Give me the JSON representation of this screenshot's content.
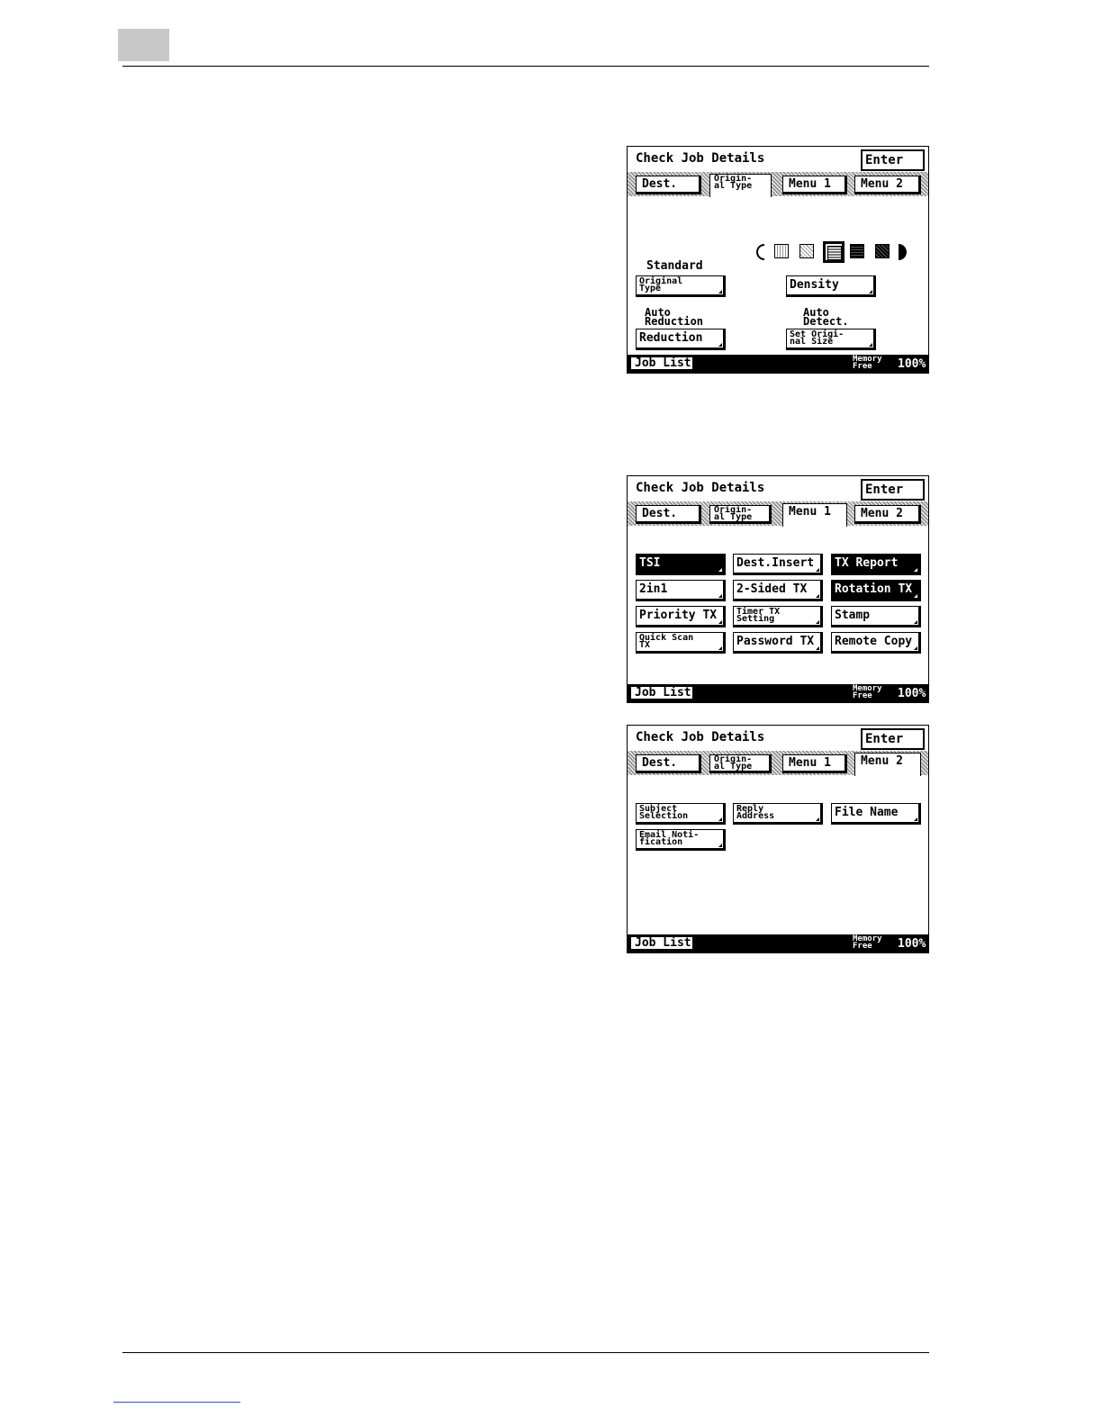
{
  "screens": [
    {
      "title": "Check Job Details",
      "enter_label": "Enter",
      "tabs": {
        "dest": "Dest.",
        "original_type": "Origin-\nal Type",
        "menu1": "Menu 1",
        "menu2": "Menu 2"
      },
      "active_tab": "original_type",
      "original_type_value": "Standard",
      "original_type_button": "Original\nType",
      "density_button": "Density",
      "reduction_value": "Auto\nReduction",
      "reduction_button": "Reduction",
      "size_value": "Auto\nDetect.",
      "size_button": "Set Origi-\nnal Size",
      "density_levels": 6,
      "density_selected": 3,
      "job_list_label": "Job List",
      "memory_label": "Memory\nFree",
      "memory_value": "100%"
    },
    {
      "title": "Check Job Details",
      "enter_label": "Enter",
      "tabs": {
        "dest": "Dest.",
        "original_type": "Origin-\nal Type",
        "menu1": "Menu 1",
        "menu2": "Menu 2"
      },
      "active_tab": "menu1",
      "buttons": [
        {
          "label": "TSI",
          "selected": true
        },
        {
          "label": "Dest.Insert",
          "selected": false
        },
        {
          "label": "TX Report",
          "selected": true
        },
        {
          "label": "2in1",
          "selected": false
        },
        {
          "label": "2-Sided TX",
          "selected": false
        },
        {
          "label": "Rotation TX",
          "selected": true
        },
        {
          "label": "Priority TX",
          "selected": false
        },
        {
          "label": "Timer TX\nSetting",
          "selected": false
        },
        {
          "label": "Stamp",
          "selected": false
        },
        {
          "label": "Quick Scan\nTX",
          "selected": false
        },
        {
          "label": "Password TX",
          "selected": false
        },
        {
          "label": "Remote Copy",
          "selected": false
        }
      ],
      "job_list_label": "Job List",
      "memory_label": "Memory\nFree",
      "memory_value": "100%"
    },
    {
      "title": "Check Job Details",
      "enter_label": "Enter",
      "tabs": {
        "dest": "Dest.",
        "original_type": "Origin-\nal Type",
        "menu1": "Menu 1",
        "menu2": "Menu 2"
      },
      "active_tab": "menu2",
      "buttons": [
        {
          "label": "Subject\nSelection"
        },
        {
          "label": "Reply\nAddress"
        },
        {
          "label": "File Name"
        },
        {
          "label": "Email Noti-\nfication"
        }
      ],
      "job_list_label": "Job List",
      "memory_label": "Memory\nFree",
      "memory_value": "100%"
    }
  ],
  "colors": {
    "text": "#000000",
    "page_tab": "#c8c8c8",
    "footer_link": "#3b4fb0"
  }
}
